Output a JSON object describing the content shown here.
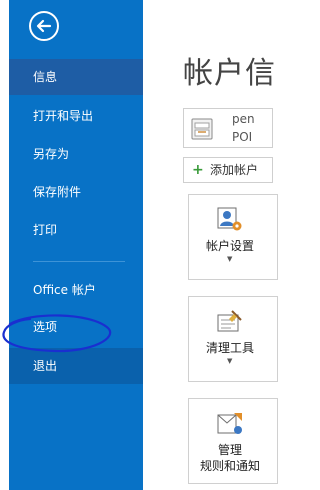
{
  "sidebar": {
    "items": [
      {
        "label": "信息",
        "selected": true
      },
      {
        "label": "打开和导出"
      },
      {
        "label": "另存为"
      },
      {
        "label": "保存附件"
      },
      {
        "label": "打印"
      },
      {
        "label": "Office 帐户"
      },
      {
        "label": "选项",
        "annotated": "hand-drawn blue circle"
      },
      {
        "label": "退出"
      }
    ]
  },
  "main": {
    "title": "帐户信",
    "account": {
      "line1": "pen",
      "line2": "POI"
    },
    "add_account_label": "添加帐户",
    "tiles": [
      {
        "label": "帐户设置",
        "icon": "account-settings-icon",
        "has_dropdown": true
      },
      {
        "label": "清理工具",
        "icon": "cleanup-tools-icon",
        "has_dropdown": true
      },
      {
        "label": "管理",
        "label2": "规则和通知",
        "icon": "rules-alerts-icon"
      }
    ]
  },
  "colors": {
    "sidebar_bg": "#0872c6",
    "selected_bg": "#1e5da5",
    "annotation": "#1a2fd0"
  }
}
